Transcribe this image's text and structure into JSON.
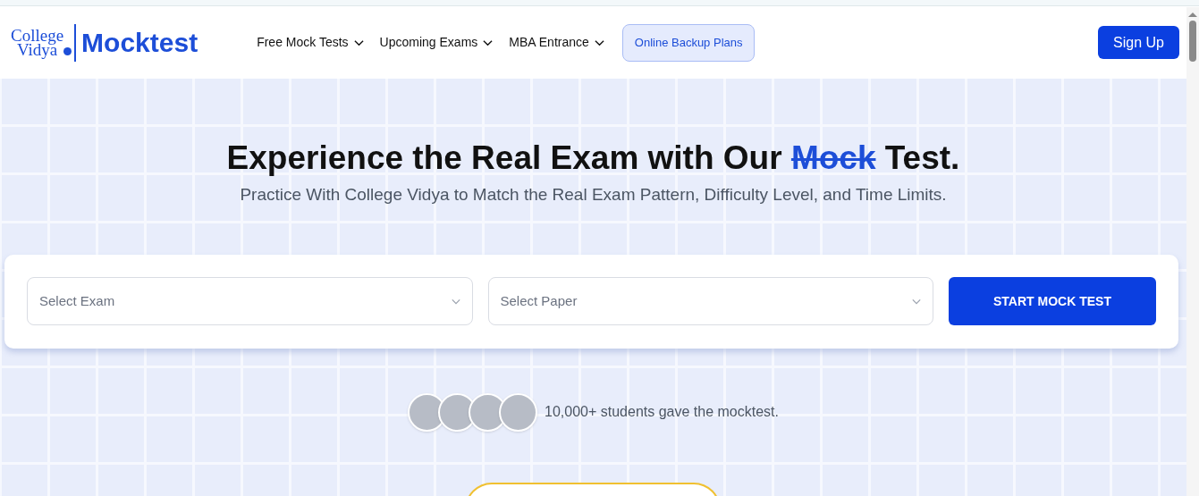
{
  "header": {
    "logo": {
      "line_1": "College",
      "line_2": "Vidya",
      "product": "Mocktest"
    },
    "nav": [
      {
        "label": "Free Mock Tests",
        "has_dropdown": true
      },
      {
        "label": "Upcoming Exams",
        "has_dropdown": true
      },
      {
        "label": "MBA Entrance",
        "has_dropdown": true
      }
    ],
    "highlight_button": "Online Backup Plans",
    "sign_up": "Sign Up"
  },
  "hero": {
    "title": {
      "before": "Experience the Real Exam with Our",
      "struck": "Mock",
      "after": "Test."
    },
    "subtitle": "Practice With College Vidya to Match the Real Exam Pattern, Difficulty Level, and Time Limits.",
    "selects": [
      {
        "placeholder": "Select Exam"
      },
      {
        "placeholder": "Select Paper"
      }
    ],
    "start_button": "START MOCK TEST",
    "social_proof": "10,000+ students gave the mocktest."
  }
}
